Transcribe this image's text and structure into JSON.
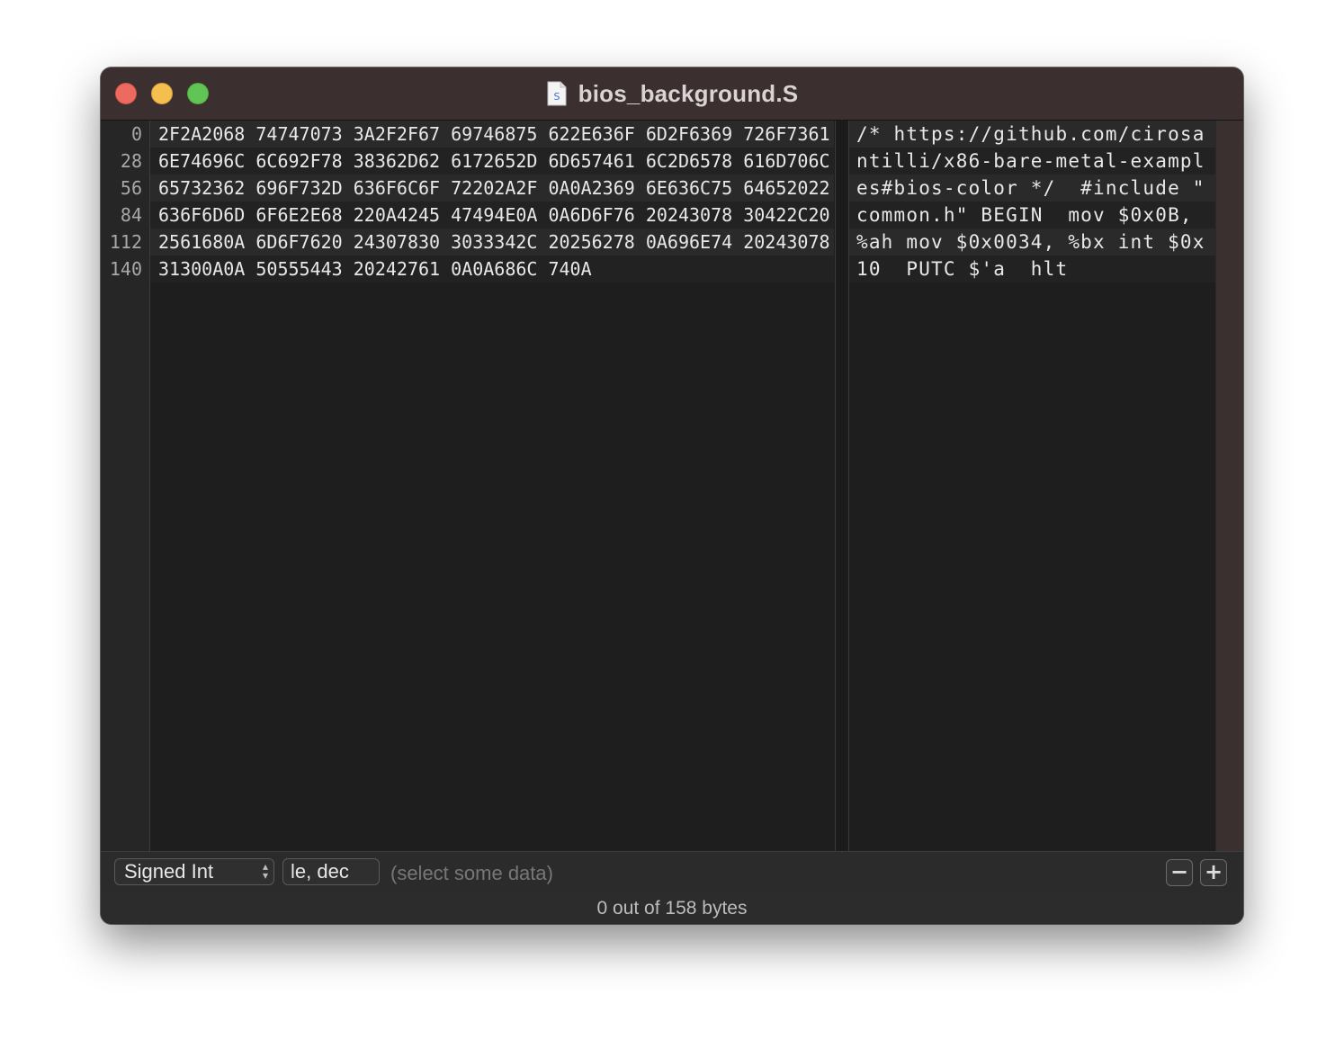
{
  "window": {
    "title": "bios_background.S",
    "file_icon_letter": "S"
  },
  "gutter": [
    "0",
    "28",
    "56",
    "84",
    "112",
    "140"
  ],
  "hex_lines": [
    "2F2A2068 74747073 3A2F2F67 69746875 622E636F 6D2F6369 726F7361",
    "6E74696C 6C692F78 38362D62 6172652D 6D657461 6C2D6578 616D706C",
    "65732362 696F732D 636F6C6F 72202A2F 0A0A2369 6E636C75 64652022",
    "636F6D6D 6F6E2E68 220A4245 47494E0A 0A6D6F76 20243078 30422C20",
    "2561680A 6D6F7620 24307830 3033342C 20256278 0A696E74 20243078",
    "31300A0A 50555443 20242761 0A0A686C 740A"
  ],
  "ascii_lines": [
    "/* https://github.com/cirosa",
    "ntilli/x86-bare-metal-exampl",
    "es#bios-color */  #include \"",
    "common.h\" BEGIN  mov $0x0B,",
    "%ah mov $0x0034, %bx int $0x",
    "10  PUTC $'a  hlt"
  ],
  "inspector": {
    "type_select": "Signed Int",
    "endian_field": "le, dec",
    "hint": "(select some data)",
    "minus_label": "−",
    "plus_label": "+"
  },
  "status": {
    "text": "0 out of 158 bytes"
  },
  "colors": {
    "titlebar": "#3b2f30",
    "close": "#ed6a5e",
    "minimize": "#f4bf4f",
    "maximize": "#61c554",
    "editor_bg": "#1e1e1e"
  }
}
